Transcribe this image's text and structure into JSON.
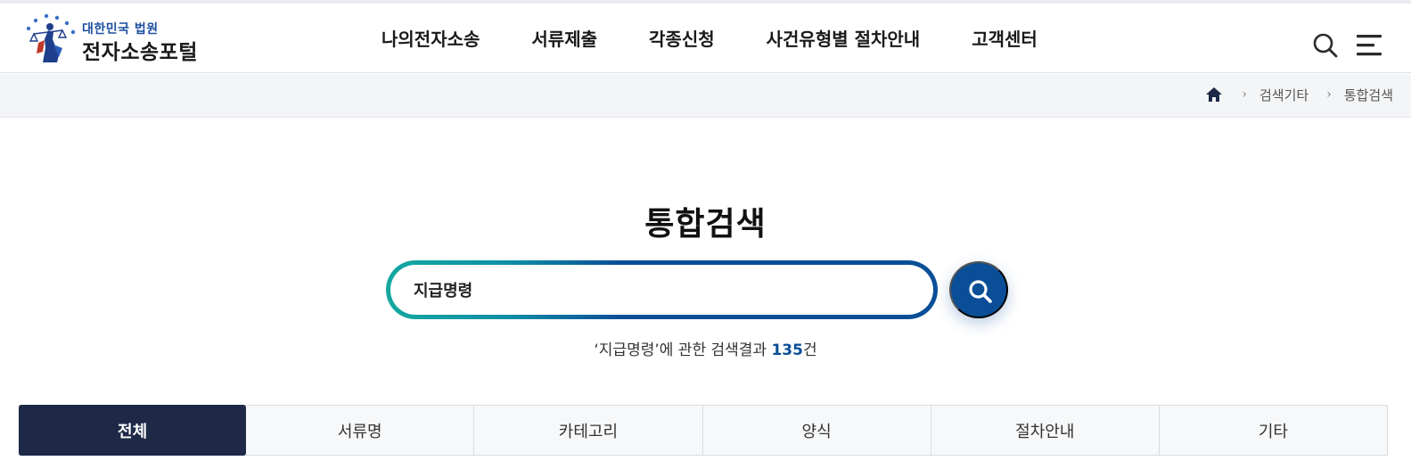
{
  "header": {
    "logo_sub": "대한민국 법원",
    "logo_main": "전자소송포털",
    "nav": [
      "나의전자소송",
      "서류제출",
      "각종신청",
      "사건유형별 절차안내",
      "고객센터"
    ],
    "search_icon": "search-icon",
    "menu_icon": "hamburger-menu-icon"
  },
  "breadcrumb": {
    "home_icon": "home-icon",
    "items": [
      "검색기타",
      "통합검색"
    ]
  },
  "main": {
    "title": "통합검색",
    "search": {
      "value": "지급명령"
    },
    "result": {
      "prefix": "‘지급명령’에 관한 검색결과 ",
      "count": "135",
      "suffix": "건"
    },
    "tabs": [
      "전체",
      "서류명",
      "카테고리",
      "양식",
      "절차안내",
      "기타"
    ],
    "active_tab": "전체"
  },
  "colors": {
    "brand_navy": "#1d2947",
    "accent_blue": "#0a4e97",
    "accent_teal": "#14a8a0"
  }
}
